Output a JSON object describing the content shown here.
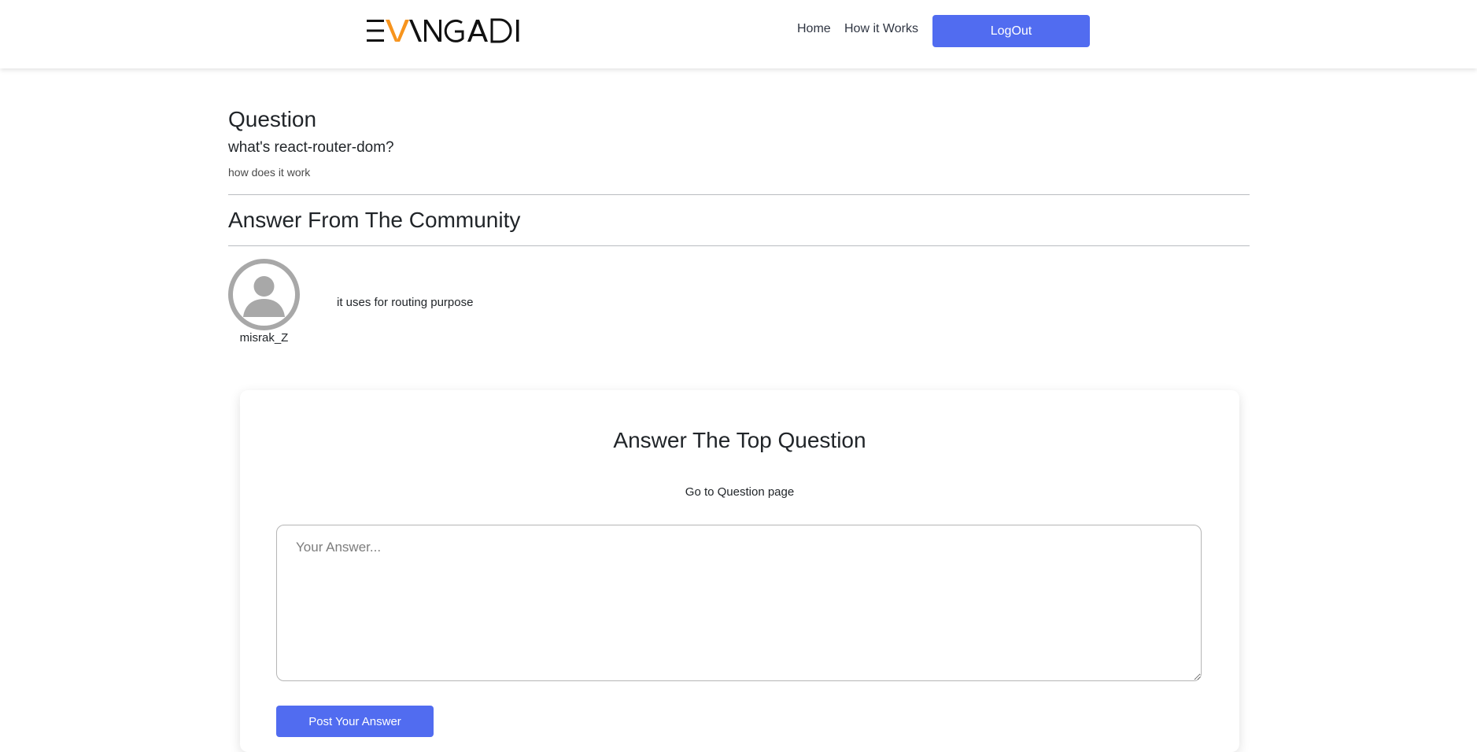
{
  "header": {
    "logo_text": "EVANGADI",
    "nav": {
      "home": "Home",
      "how_it_works": "How it Works"
    },
    "logout_label": "LogOut"
  },
  "question": {
    "heading": "Question",
    "title": "what's react-router-dom?",
    "description": "how does it work"
  },
  "community": {
    "heading": "Answer From The Community",
    "answers": [
      {
        "username": "misrak_Z",
        "text": "it uses for routing purpose"
      }
    ]
  },
  "answer_form": {
    "title": "Answer The Top Question",
    "link": "Go to Question page",
    "placeholder": "Your Answer...",
    "submit_label": "Post Your Answer"
  },
  "colors": {
    "primary_button": "#516cf0",
    "logo_accent": "#f7941d",
    "divider": "#b9bcc0",
    "avatar_gray": "#a8a8a8"
  },
  "icons": {
    "avatar": "user-silhouette-icon"
  }
}
